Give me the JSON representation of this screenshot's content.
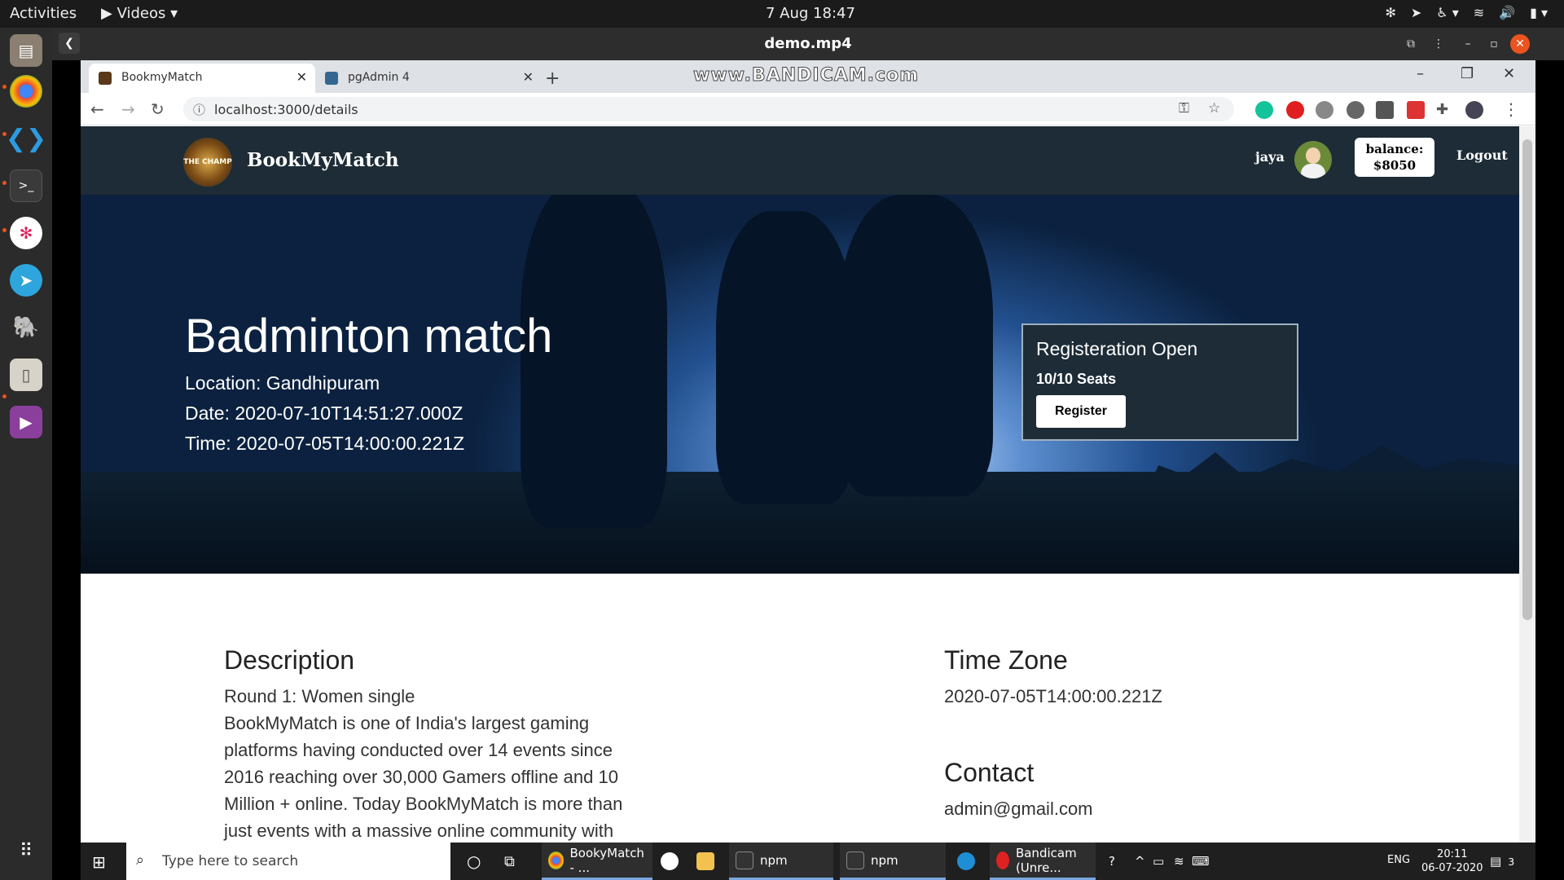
{
  "topbar": {
    "activities": "Activities",
    "app_menu": "▶ Videos ▾",
    "clock": "7 Aug  18:47"
  },
  "player": {
    "title": "demo.mp4"
  },
  "browser": {
    "tabs": [
      {
        "label": "BookmyMatch"
      },
      {
        "label": "pgAdmin 4"
      }
    ],
    "watermark": "www.BANDICAM.com",
    "url": "localhost:3000/details"
  },
  "site": {
    "brand": "BookMyMatch",
    "logo_text": "THE CHAMP",
    "username": "jaya",
    "balance_label": "balance:",
    "balance_value": "$8050",
    "logout": "Logout"
  },
  "hero": {
    "title": "Badminton match",
    "location": "Location: Gandhipuram",
    "date": "Date: 2020-07-10T14:51:27.000Z",
    "time": "Time: 2020-07-05T14:00:00.221Z"
  },
  "registration": {
    "status": "Registeration Open",
    "seats": "10/10 Seats",
    "button": "Register"
  },
  "details": {
    "description_heading": "Description",
    "description_lines": [
      "Round 1: Women single",
      "BookMyMatch is one of India's largest gaming",
      "platforms having conducted over 14 events since",
      "2016 reaching over 30,000 Gamers offline and 10",
      "Million + online. Today BookMyMatch is more than",
      "just events with a massive online community with"
    ],
    "timezone_heading": "Time Zone",
    "timezone_value": "2020-07-05T14:00:00.221Z",
    "contact_heading": "Contact",
    "contact_value": "admin@gmail.com"
  },
  "taskbar": {
    "search_placeholder": "Type here to search",
    "items": [
      {
        "label": "BookyMatch - ..."
      },
      {
        "label": "npm"
      },
      {
        "label": "npm"
      },
      {
        "label": "Bandicam (Unre..."
      }
    ],
    "lang": "ENG",
    "time": "20:11",
    "date": "06-07-2020",
    "notifications": "3"
  },
  "colors": {
    "navbar": "#1d2c36",
    "ubuntu_accent": "#e95420",
    "taskbar": "#1f1f1f"
  }
}
